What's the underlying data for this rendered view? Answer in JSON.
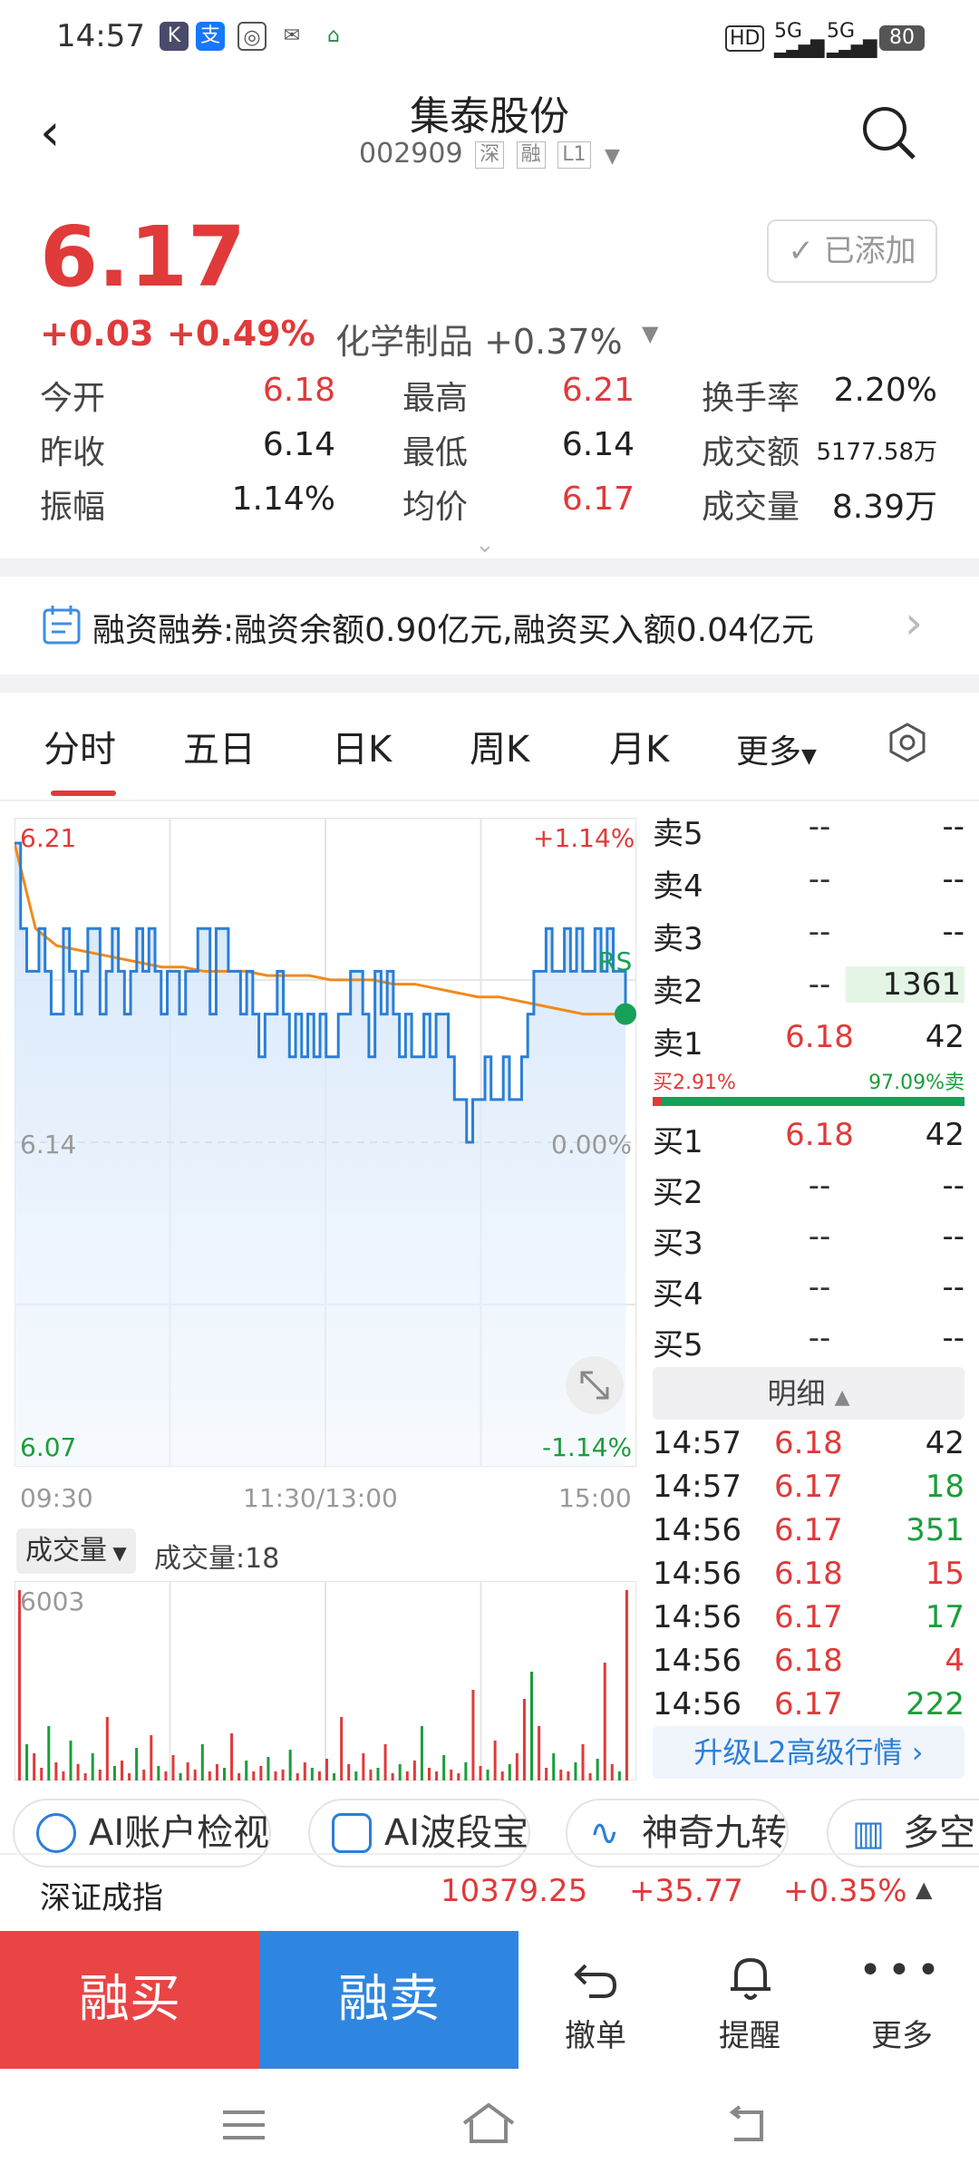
{
  "status": {
    "time": "14:57",
    "battery": "80",
    "net1": "5G",
    "net2": "5G",
    "hd": "HD"
  },
  "header": {
    "title": "集泰股份",
    "code": "002909",
    "tags": [
      "深",
      "融",
      "L1"
    ]
  },
  "quote": {
    "price": "6.17",
    "change": "+0.03",
    "change_pct": "+0.49%",
    "sector": "化学制品 +0.37%",
    "added_label": "已添加",
    "stats": [
      {
        "label": "今开",
        "value": "6.18",
        "color": "#e03a3a"
      },
      {
        "label": "最高",
        "value": "6.21",
        "color": "#e03a3a"
      },
      {
        "label": "换手率",
        "value": "2.20%",
        "color": "#222222"
      },
      {
        "label": "昨收",
        "value": "6.14",
        "color": "#222222"
      },
      {
        "label": "最低",
        "value": "6.14",
        "color": "#222222"
      },
      {
        "label": "成交额",
        "value": "5177.58万",
        "color": "#222222"
      },
      {
        "label": "振幅",
        "value": "1.14%",
        "color": "#222222"
      },
      {
        "label": "均价",
        "value": "6.17",
        "color": "#e03a3a"
      },
      {
        "label": "成交量",
        "value": "8.39万",
        "color": "#222222"
      }
    ]
  },
  "margin": {
    "text": "融资融券:融资余额0.90亿元,融资买入额0.04亿元"
  },
  "tabs": [
    "分时",
    "五日",
    "日K",
    "周K",
    "月K",
    "更多"
  ],
  "chart_labels": {
    "top_left": "6.21",
    "top_right": "+1.14%",
    "mid_left": "6.14",
    "mid_right": "0.00%",
    "bot_left": "6.07",
    "bot_right": "-1.14%",
    "time_start": "09:30",
    "time_mid": "11:30/13:00",
    "time_end": "15:00",
    "marker": "RS",
    "vol_selector": "成交量",
    "vol_info": "成交量:18",
    "vol_max": "6003"
  },
  "chart_data": {
    "type": "line",
    "ylim": [
      6.07,
      6.21
    ],
    "series": [
      {
        "values": [
          6.21,
          6.19,
          6.18,
          6.18,
          6.19,
          6.18,
          6.17,
          6.17,
          6.19,
          6.18,
          6.17,
          6.18,
          6.19,
          6.19,
          6.17,
          6.18,
          6.19,
          6.18,
          6.17,
          6.18,
          6.19,
          6.18,
          6.19,
          6.18,
          6.17,
          6.18,
          6.18,
          6.17,
          6.18,
          6.18,
          6.19,
          6.19,
          6.17,
          6.19,
          6.19,
          6.18,
          6.18,
          6.17,
          6.18,
          6.17,
          6.16,
          6.17,
          6.17,
          6.18,
          6.17,
          6.16,
          6.17,
          6.16,
          6.17,
          6.16,
          6.17,
          6.16,
          6.16,
          6.17,
          6.17,
          6.18,
          6.18,
          6.17,
          6.16,
          6.18,
          6.17,
          6.18,
          6.17,
          6.16,
          6.17,
          6.16,
          6.16,
          6.17,
          6.16,
          6.17,
          6.17,
          6.16,
          6.15,
          6.15,
          6.14,
          6.15,
          6.15,
          6.16,
          6.15,
          6.15,
          6.16,
          6.15,
          6.15,
          6.16,
          6.17,
          6.18,
          6.18,
          6.19,
          6.18,
          6.18,
          6.19,
          6.18,
          6.19,
          6.18,
          6.18,
          6.19,
          6.18,
          6.19,
          6.18,
          6.18,
          6.17
        ]
      },
      {
        "values": [
          6.21,
          6.19,
          6.186,
          6.185,
          6.184,
          6.183,
          6.182,
          6.181,
          6.181,
          6.18,
          6.18,
          6.18,
          6.179,
          6.179,
          6.179,
          6.178,
          6.178,
          6.178,
          6.177,
          6.177,
          6.176,
          6.175,
          6.174,
          6.174,
          6.173,
          6.172,
          6.171,
          6.17,
          6.17,
          6.17
        ]
      }
    ]
  },
  "orderbook": {
    "sell": [
      {
        "label": "卖5",
        "price": "--",
        "vol": "--"
      },
      {
        "label": "卖4",
        "price": "--",
        "vol": "--"
      },
      {
        "label": "卖3",
        "price": "--",
        "vol": "--"
      },
      {
        "label": "卖2",
        "price": "--",
        "vol": "1361"
      },
      {
        "label": "卖1",
        "price": "6.18",
        "vol": "42"
      }
    ],
    "ratio_buy": "买2.91%",
    "ratio_sell": "97.09%卖",
    "ratio_buy_fraction": 0.0291,
    "buy": [
      {
        "label": "买1",
        "price": "6.18",
        "vol": "42"
      },
      {
        "label": "买2",
        "price": "--",
        "vol": "--"
      },
      {
        "label": "买3",
        "price": "--",
        "vol": "--"
      },
      {
        "label": "买4",
        "price": "--",
        "vol": "--"
      },
      {
        "label": "买5",
        "price": "--",
        "vol": "--"
      }
    ]
  },
  "details": {
    "header": "明细",
    "rows": [
      {
        "time": "14:57",
        "price": "6.18",
        "vol": "42",
        "pc": "#e03a3a",
        "vc": "#222222"
      },
      {
        "time": "14:57",
        "price": "6.17",
        "vol": "18",
        "pc": "#e03a3a",
        "vc": "#1a9e3a"
      },
      {
        "time": "14:56",
        "price": "6.17",
        "vol": "351",
        "pc": "#e03a3a",
        "vc": "#1a9e3a"
      },
      {
        "time": "14:56",
        "price": "6.18",
        "vol": "15",
        "pc": "#e03a3a",
        "vc": "#e03a3a"
      },
      {
        "time": "14:56",
        "price": "6.17",
        "vol": "17",
        "pc": "#e03a3a",
        "vc": "#1a9e3a"
      },
      {
        "time": "14:56",
        "price": "6.18",
        "vol": "4",
        "pc": "#e03a3a",
        "vc": "#e03a3a"
      },
      {
        "time": "14:56",
        "price": "6.17",
        "vol": "222",
        "pc": "#e03a3a",
        "vc": "#1a9e3a"
      }
    ],
    "upgrade": "升级L2高级行情 ›"
  },
  "tools": [
    "AI账户检视",
    "AI波段宝",
    "神奇九转",
    "多空"
  ],
  "index": {
    "name": "深证成指",
    "value": "10379.25",
    "change": "+35.77",
    "pct": "+0.35%"
  },
  "actions": {
    "buy": "融买",
    "sell": "融卖",
    "cancel": "撤单",
    "alert": "提醒",
    "more": "更多"
  }
}
